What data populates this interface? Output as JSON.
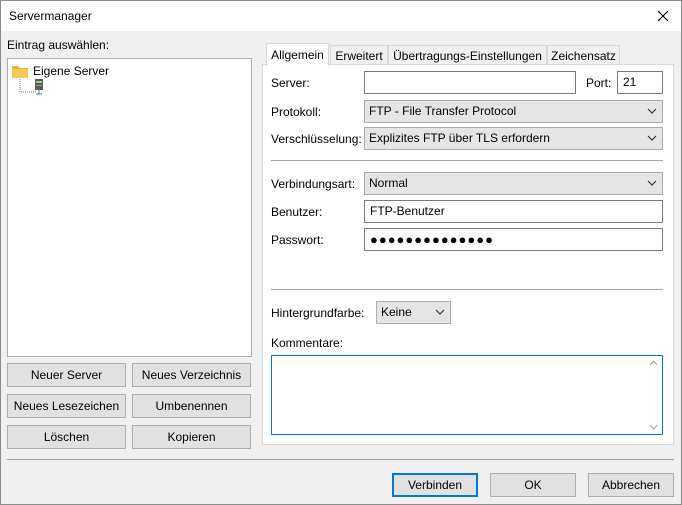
{
  "window": {
    "title": "Servermanager"
  },
  "left": {
    "select_label": "Eintrag auswählen:",
    "tree_root": "Eigene Server",
    "buttons": {
      "new_server": "Neuer Server",
      "new_folder": "Neues Verzeichnis",
      "new_bookmark": "Neues Lesezeichen",
      "rename": "Umbenennen",
      "delete": "Löschen",
      "copy": "Kopieren"
    }
  },
  "tabs": [
    "Allgemein",
    "Erweitert",
    "Übertragungs-Einstellungen",
    "Zeichensatz"
  ],
  "general": {
    "server_label": "Server:",
    "server_value": "",
    "port_label": "Port:",
    "port_value": "21",
    "protocol_label": "Protokoll:",
    "protocol_value": "FTP - File Transfer Protocol",
    "encryption_label": "Verschlüsselung:",
    "encryption_value": "Explizites FTP über TLS erfordern",
    "logon_label": "Verbindungsart:",
    "logon_value": "Normal",
    "user_label": "Benutzer:",
    "user_value": "FTP-Benutzer",
    "password_label": "Passwort:",
    "password_value": "●●●●●●●●●●●●●●",
    "bgcolor_label": "Hintergrundfarbe:",
    "bgcolor_value": "Keine",
    "comments_label": "Kommentare:",
    "comments_value": ""
  },
  "footer": {
    "connect": "Verbinden",
    "ok": "OK",
    "cancel": "Abbrechen"
  },
  "colors": {
    "accent": "#0078d7",
    "folder": "#e8b339"
  }
}
